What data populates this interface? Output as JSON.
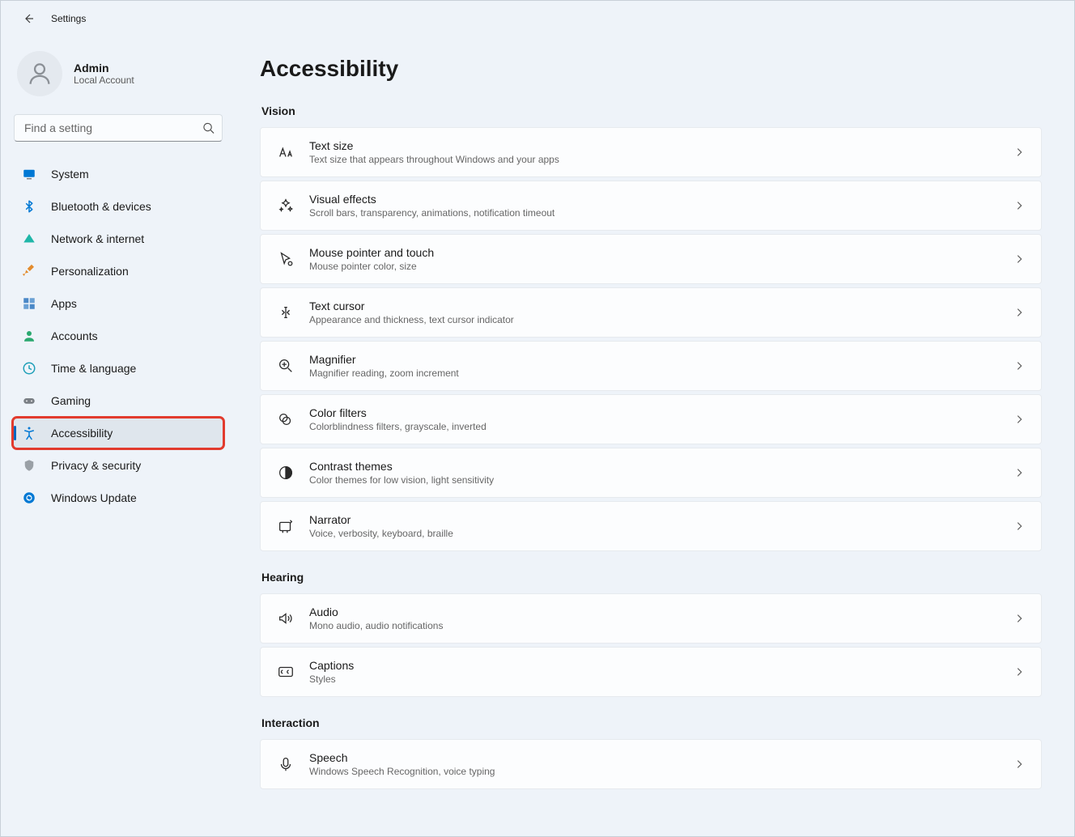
{
  "window": {
    "title": "Settings"
  },
  "profile": {
    "name": "Admin",
    "sub": "Local Account"
  },
  "search": {
    "placeholder": "Find a setting"
  },
  "nav": [
    {
      "id": "system",
      "label": "System",
      "icon": "system"
    },
    {
      "id": "bluetooth",
      "label": "Bluetooth & devices",
      "icon": "bluetooth"
    },
    {
      "id": "network",
      "label": "Network & internet",
      "icon": "network"
    },
    {
      "id": "personalization",
      "label": "Personalization",
      "icon": "personalization"
    },
    {
      "id": "apps",
      "label": "Apps",
      "icon": "apps"
    },
    {
      "id": "accounts",
      "label": "Accounts",
      "icon": "accounts"
    },
    {
      "id": "time",
      "label": "Time & language",
      "icon": "time"
    },
    {
      "id": "gaming",
      "label": "Gaming",
      "icon": "gaming"
    },
    {
      "id": "accessibility",
      "label": "Accessibility",
      "icon": "accessibility",
      "active": true,
      "highlighted": true
    },
    {
      "id": "privacy",
      "label": "Privacy & security",
      "icon": "privacy"
    },
    {
      "id": "update",
      "label": "Windows Update",
      "icon": "update"
    }
  ],
  "page": {
    "title": "Accessibility",
    "sections": [
      {
        "title": "Vision",
        "items": [
          {
            "id": "textsize",
            "icon": "textsize",
            "title": "Text size",
            "sub": "Text size that appears throughout Windows and your apps"
          },
          {
            "id": "visualeffects",
            "icon": "visualeffects",
            "title": "Visual effects",
            "sub": "Scroll bars, transparency, animations, notification timeout"
          },
          {
            "id": "mousepointer",
            "icon": "mousepointer",
            "title": "Mouse pointer and touch",
            "sub": "Mouse pointer color, size"
          },
          {
            "id": "textcursor",
            "icon": "textcursor",
            "title": "Text cursor",
            "sub": "Appearance and thickness, text cursor indicator"
          },
          {
            "id": "magnifier",
            "icon": "magnifier",
            "title": "Magnifier",
            "sub": "Magnifier reading, zoom increment"
          },
          {
            "id": "colorfilters",
            "icon": "colorfilters",
            "title": "Color filters",
            "sub": "Colorblindness filters, grayscale, inverted"
          },
          {
            "id": "contrast",
            "icon": "contrast",
            "title": "Contrast themes",
            "sub": "Color themes for low vision, light sensitivity"
          },
          {
            "id": "narrator",
            "icon": "narrator",
            "title": "Narrator",
            "sub": "Voice, verbosity, keyboard, braille"
          }
        ]
      },
      {
        "title": "Hearing",
        "items": [
          {
            "id": "audio",
            "icon": "audio",
            "title": "Audio",
            "sub": "Mono audio, audio notifications"
          },
          {
            "id": "captions",
            "icon": "captions",
            "title": "Captions",
            "sub": "Styles"
          }
        ]
      },
      {
        "title": "Interaction",
        "items": [
          {
            "id": "speech",
            "icon": "speech",
            "title": "Speech",
            "sub": "Windows Speech Recognition, voice typing"
          }
        ]
      }
    ]
  }
}
